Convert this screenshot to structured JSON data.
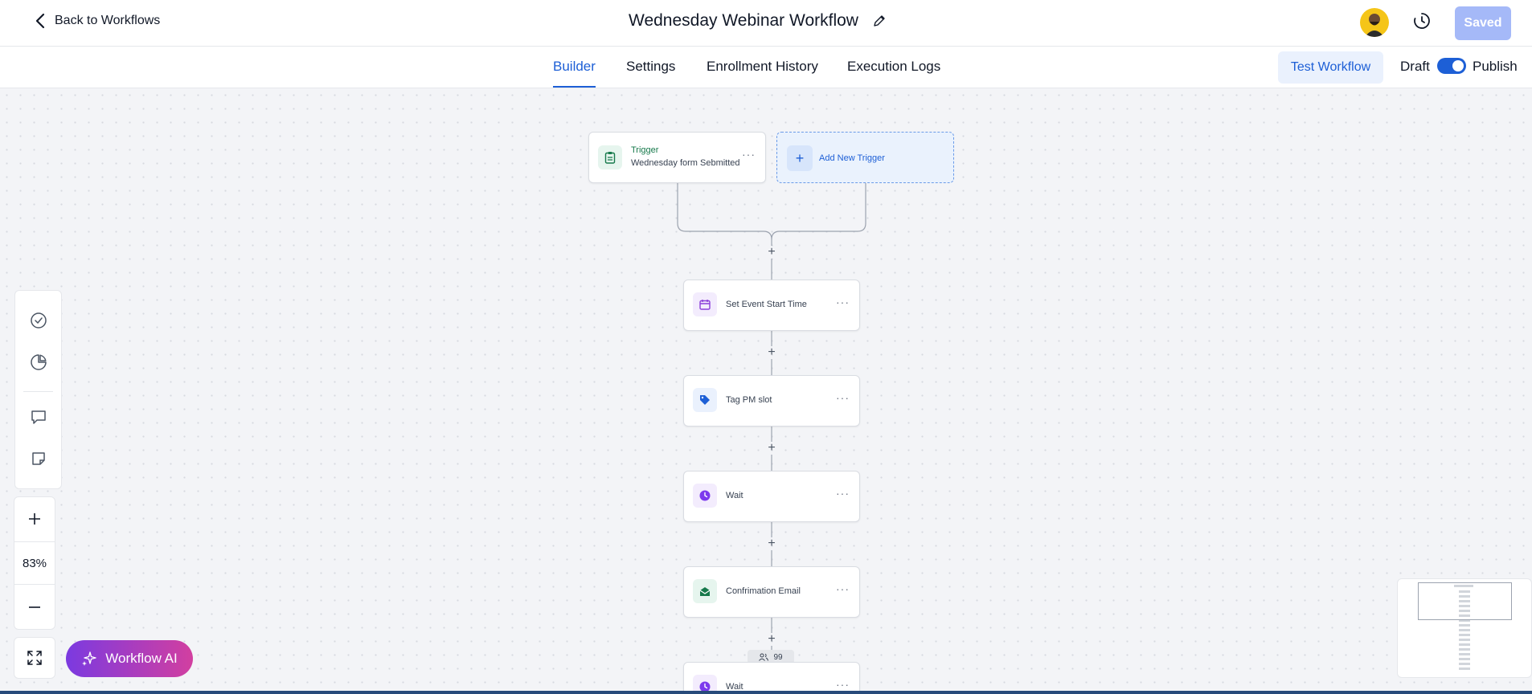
{
  "header": {
    "back_label": "Back to Workflows",
    "title": "Wednesday Webinar Workflow",
    "saved_label": "Saved"
  },
  "tabs": [
    {
      "label": "Builder",
      "active": true
    },
    {
      "label": "Settings",
      "active": false
    },
    {
      "label": "Enrollment History",
      "active": false
    },
    {
      "label": "Execution Logs",
      "active": false
    }
  ],
  "actions": {
    "test_label": "Test Workflow",
    "draft_label": "Draft",
    "publish_label": "Publish",
    "publish_on": true
  },
  "trigger": {
    "title": "Trigger",
    "subtitle": "Wednesday form Sebmitted"
  },
  "add_trigger_label": "Add New Trigger",
  "steps": [
    {
      "label": "Set Event Start Time",
      "icon": "calendar-icon"
    },
    {
      "label": "Tag PM slot",
      "icon": "tag-icon"
    },
    {
      "label": "Wait",
      "icon": "clock-icon"
    },
    {
      "label": "Confrimation Email",
      "icon": "email-icon"
    },
    {
      "label": "Wait",
      "icon": "clock-icon"
    }
  ],
  "counter": "99",
  "zoom_level": "83%",
  "ai_label": "Workflow AI",
  "colors": {
    "accent": "#1d5fd6",
    "trigger_green": "#16794b",
    "ai_gradient_start": "#7b3ae0",
    "ai_gradient_end": "#d23fa0"
  }
}
